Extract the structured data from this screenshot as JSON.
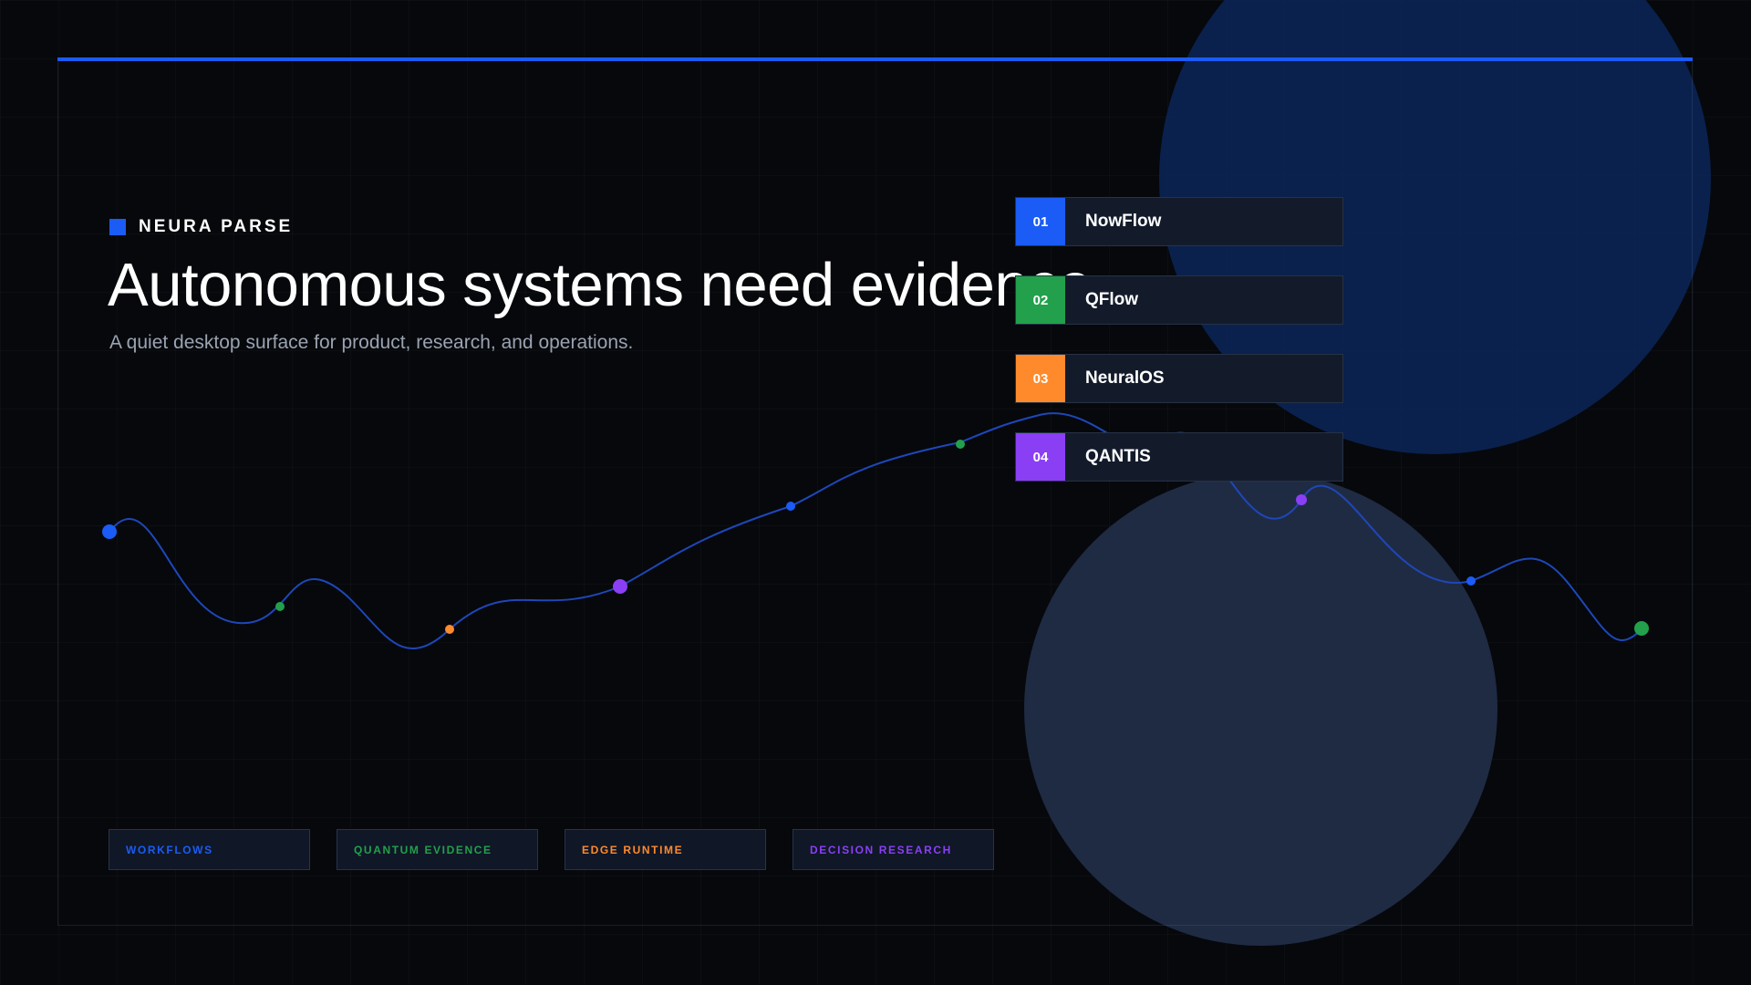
{
  "brand": {
    "name": "NEURA PARSE",
    "accent": "#1a5cf5"
  },
  "hero": {
    "title": "Autonomous systems need evidence",
    "subtitle": "A quiet desktop surface for product, research, and operations."
  },
  "list": [
    {
      "number": "01",
      "label": "NowFlow",
      "color": "#1a5cf5"
    },
    {
      "number": "02",
      "label": "QFlow",
      "color": "#22a04b"
    },
    {
      "number": "03",
      "label": "NeuralOS",
      "color": "#ff8a2b"
    },
    {
      "number": "04",
      "label": "QANTIS",
      "color": "#8a3ff5"
    }
  ],
  "tags": [
    {
      "label": "WORKFLOWS",
      "color": "#1a5cf5"
    },
    {
      "label": "QUANTUM EVIDENCE",
      "color": "#22a04b"
    },
    {
      "label": "EDGE RUNTIME",
      "color": "#ff8a2b"
    },
    {
      "label": "DECISION RESEARCH",
      "color": "#8a3ff5"
    }
  ]
}
